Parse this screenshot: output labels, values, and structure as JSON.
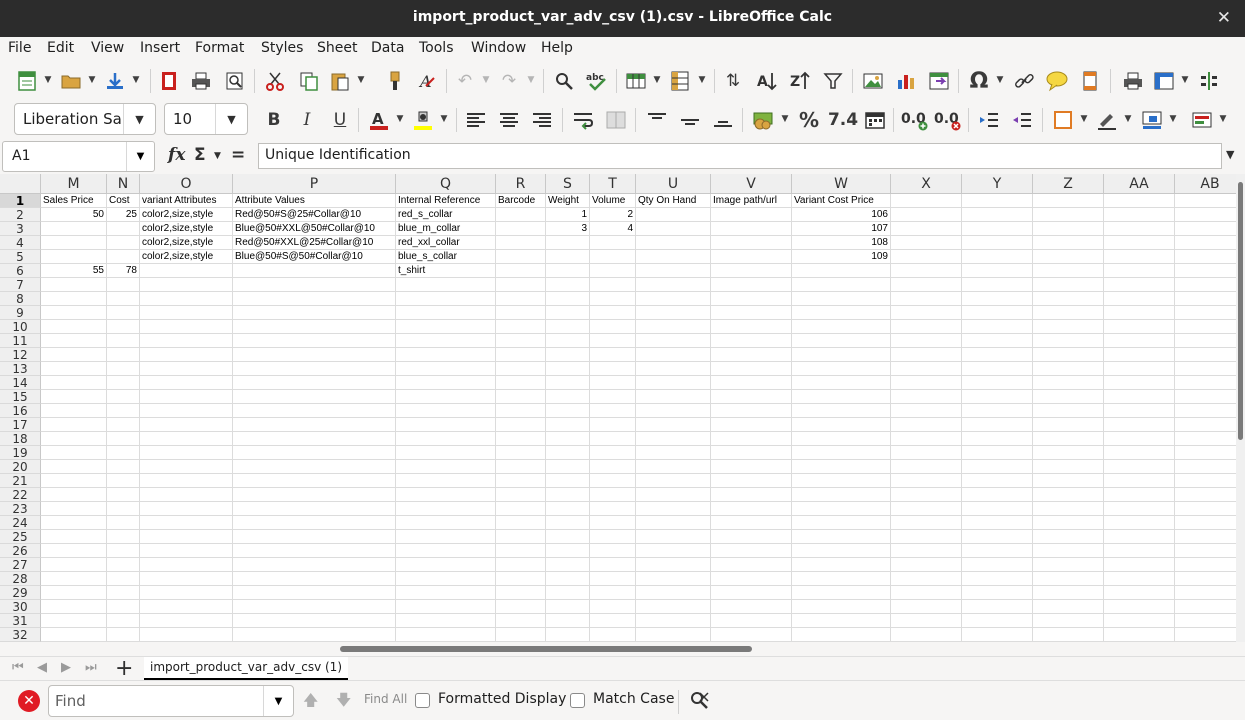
{
  "window": {
    "title": "import_product_var_adv_csv (1).csv - LibreOffice Calc"
  },
  "menu": [
    "File",
    "Edit",
    "View",
    "Insert",
    "Format",
    "Styles",
    "Sheet",
    "Data",
    "Tools",
    "Window",
    "Help"
  ],
  "format_toolbar": {
    "font_name": "Liberation Sa",
    "font_size": "10",
    "percent_label": "%",
    "number_label": "7.4",
    "decimal_add": "0.0",
    "decimal_remove": "0.0"
  },
  "formula_bar": {
    "cell_ref": "A1",
    "content": "Unique Identification"
  },
  "columns": [
    {
      "name": "M",
      "w": 66
    },
    {
      "name": "N",
      "w": 33
    },
    {
      "name": "O",
      "w": 93
    },
    {
      "name": "P",
      "w": 163
    },
    {
      "name": "Q",
      "w": 100
    },
    {
      "name": "R",
      "w": 50
    },
    {
      "name": "S",
      "w": 44
    },
    {
      "name": "T",
      "w": 46
    },
    {
      "name": "U",
      "w": 75
    },
    {
      "name": "V",
      "w": 81
    },
    {
      "name": "W",
      "w": 99
    },
    {
      "name": "X",
      "w": 71
    },
    {
      "name": "Y",
      "w": 71
    },
    {
      "name": "Z",
      "w": 71
    },
    {
      "name": "AA",
      "w": 71
    },
    {
      "name": "AB",
      "w": 71
    }
  ],
  "row_count": 32,
  "active_row": 1,
  "cells": [
    {
      "r": 1,
      "c": 0,
      "v": "Sales Price"
    },
    {
      "r": 1,
      "c": 1,
      "v": "Cost"
    },
    {
      "r": 1,
      "c": 2,
      "v": "variant Attributes"
    },
    {
      "r": 1,
      "c": 3,
      "v": "Attribute Values"
    },
    {
      "r": 1,
      "c": 4,
      "v": "Internal Reference"
    },
    {
      "r": 1,
      "c": 5,
      "v": "Barcode"
    },
    {
      "r": 1,
      "c": 6,
      "v": "Weight"
    },
    {
      "r": 1,
      "c": 7,
      "v": "Volume"
    },
    {
      "r": 1,
      "c": 8,
      "v": "Qty On Hand"
    },
    {
      "r": 1,
      "c": 9,
      "v": "Image path/url"
    },
    {
      "r": 1,
      "c": 10,
      "v": "Variant Cost Price"
    },
    {
      "r": 2,
      "c": 0,
      "v": "50",
      "num": true
    },
    {
      "r": 2,
      "c": 1,
      "v": "25",
      "num": true
    },
    {
      "r": 2,
      "c": 2,
      "v": "color2,size,style"
    },
    {
      "r": 2,
      "c": 3,
      "v": "Red@50#S@25#Collar@10"
    },
    {
      "r": 2,
      "c": 4,
      "v": "red_s_collar"
    },
    {
      "r": 2,
      "c": 6,
      "v": "1",
      "num": true
    },
    {
      "r": 2,
      "c": 7,
      "v": "2",
      "num": true
    },
    {
      "r": 2,
      "c": 10,
      "v": "106",
      "num": true
    },
    {
      "r": 3,
      "c": 2,
      "v": "color2,size,style"
    },
    {
      "r": 3,
      "c": 3,
      "v": "Blue@50#XXL@50#Collar@10"
    },
    {
      "r": 3,
      "c": 4,
      "v": "blue_m_collar"
    },
    {
      "r": 3,
      "c": 6,
      "v": "3",
      "num": true
    },
    {
      "r": 3,
      "c": 7,
      "v": "4",
      "num": true
    },
    {
      "r": 3,
      "c": 10,
      "v": "107",
      "num": true
    },
    {
      "r": 4,
      "c": 2,
      "v": "color2,size,style"
    },
    {
      "r": 4,
      "c": 3,
      "v": "Red@50#XXL@25#Collar@10"
    },
    {
      "r": 4,
      "c": 4,
      "v": "red_xxl_collar"
    },
    {
      "r": 4,
      "c": 10,
      "v": "108",
      "num": true
    },
    {
      "r": 5,
      "c": 2,
      "v": "color2,size,style"
    },
    {
      "r": 5,
      "c": 3,
      "v": "Blue@50#S@50#Collar@10"
    },
    {
      "r": 5,
      "c": 4,
      "v": "blue_s_collar"
    },
    {
      "r": 5,
      "c": 10,
      "v": "109",
      "num": true
    },
    {
      "r": 6,
      "c": 0,
      "v": "55",
      "num": true
    },
    {
      "r": 6,
      "c": 1,
      "v": "78",
      "num": true
    },
    {
      "r": 6,
      "c": 4,
      "v": "t_shirt"
    }
  ],
  "sheet_tabs": [
    "import_product_var_adv_csv (1)"
  ],
  "find_bar": {
    "placeholder": "Find",
    "find_all": "Find All",
    "formatted_display": "Formatted Display",
    "match_case": "Match Case"
  },
  "colors": {
    "titlebar": "#2c2c2c",
    "chrome": "#f6f5f4",
    "font_color_red": "#c9211e",
    "highlight_yellow": "#ffff00",
    "close_red": "#e01b24"
  }
}
